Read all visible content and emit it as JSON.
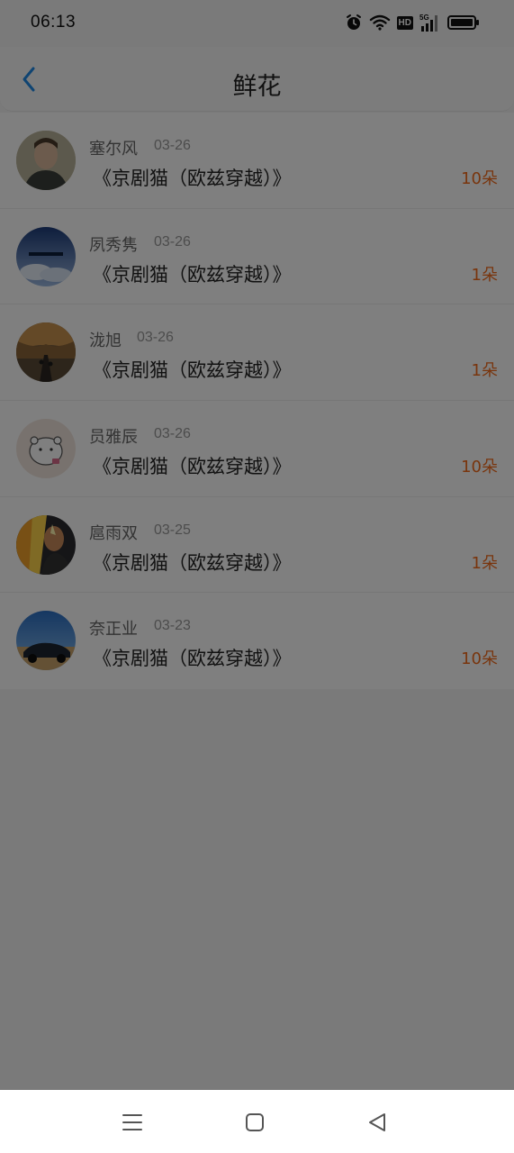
{
  "status_bar": {
    "time": "06:13",
    "icons": [
      "alarm-icon",
      "wifi-icon",
      "hd-icon",
      "5g-signal-icon",
      "battery-icon"
    ],
    "hd_label": "HD"
  },
  "header": {
    "title": "鲜花",
    "back_icon": "chevron-left-icon"
  },
  "colors": {
    "accent_blue": "#1e88e5",
    "flower_count": "#f26a1b",
    "title_text": "#222222",
    "muted_text": "#999999"
  },
  "list": {
    "items": [
      {
        "name": "塞尔风",
        "date": "03-26",
        "work": "《京剧猫（欧兹穿越）》",
        "count": "10朵"
      },
      {
        "name": "夙秀隽",
        "date": "03-26",
        "work": "《京剧猫（欧兹穿越）》",
        "count": "1朵"
      },
      {
        "name": "泷旭",
        "date": "03-26",
        "work": "《京剧猫（欧兹穿越）》",
        "count": "1朵"
      },
      {
        "name": "员雅辰",
        "date": "03-26",
        "work": "《京剧猫（欧兹穿越）》",
        "count": "10朵"
      },
      {
        "name": "扈雨双",
        "date": "03-25",
        "work": "《京剧猫（欧兹穿越）》",
        "count": "1朵"
      },
      {
        "name": "奈正业",
        "date": "03-23",
        "work": "《京剧猫（欧兹穿越）》",
        "count": "10朵"
      }
    ]
  },
  "system_nav": {
    "icons": [
      "menu-icon",
      "home-square-icon",
      "back-triangle-icon"
    ]
  }
}
